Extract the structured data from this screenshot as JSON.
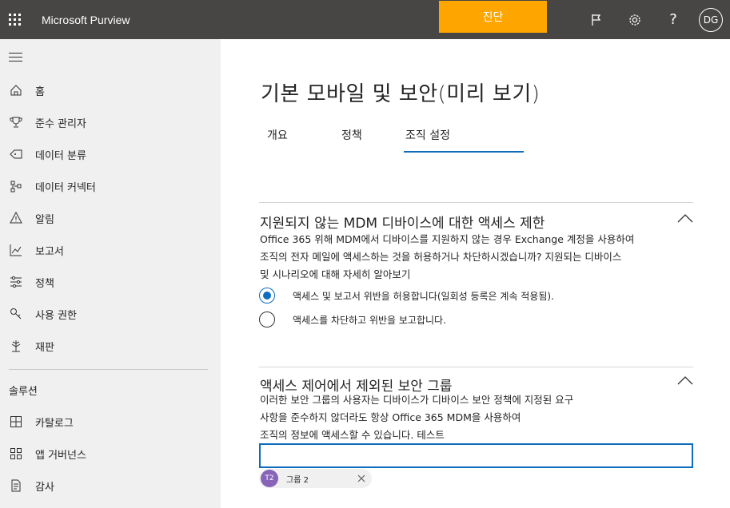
{
  "topbar": {
    "app_title": "Microsoft Purview",
    "diagnostic_label": "진단",
    "avatar_initials": "DG",
    "help_glyph": "?",
    "accent_color": "#ffa500"
  },
  "sidebar": {
    "items": [
      {
        "label": "홈",
        "icon": "home-icon"
      },
      {
        "label": "준수 관리자",
        "icon": "trophy-icon"
      },
      {
        "label": "데이터 분류",
        "icon": "tag-icon"
      },
      {
        "label": "데이터 커넥터",
        "icon": "connector-icon"
      },
      {
        "label": "알림",
        "icon": "alert-icon"
      },
      {
        "label": "보고서",
        "icon": "chart-icon"
      },
      {
        "label": "정책",
        "icon": "sliders-icon"
      },
      {
        "label": "사용 권한",
        "icon": "key-icon"
      },
      {
        "label": "재판",
        "icon": "tree-icon"
      }
    ],
    "section_label": "솔루션",
    "solutions": [
      {
        "label": "카탈로그",
        "icon": "catalog-icon"
      },
      {
        "label": "앱 거버넌스",
        "icon": "app-grid-icon"
      },
      {
        "label": "감사",
        "icon": "audit-icon"
      }
    ]
  },
  "main": {
    "title": "기본 모바일 및 보안(미리 보기)",
    "tabs": [
      {
        "label": "개요"
      },
      {
        "label": "정책"
      },
      {
        "label": "조직 설정"
      }
    ],
    "selected_tab": "조직 설정",
    "section1": {
      "title": "지원되지 않는 MDM 디바이스에 대한 액세스 제한",
      "desc_lines": [
        "Office 365 위해 MDM에서 디바이스를 지원하지 않는 경우 Exchange 계정을 사용하여",
        "조직의 전자 메일에 액세스하는 것을 허용하거나 차단하시겠습니까? 지원되는 디바이스",
        "및 시나리오에 대해 자세히 알아보기"
      ],
      "options": [
        {
          "label": "액세스 및 보고서 위반을 허용합니다(일회성 등록은 계속 적용됨).",
          "checked": true
        },
        {
          "label": "액세스를 차단하고 위반을 보고합니다.",
          "checked": false
        }
      ]
    },
    "section2": {
      "title": "액세스 제어에서 제외된 보안 그룹",
      "desc_lines": [
        "이러한 보안 그룹의 사용자는 디바이스가 디바이스 보안 정책에 지정된 요구",
        "사항을 준수하지 않더라도 항상 Office 365 MDM을 사용하여",
        "조직의 정보에 액세스할 수 있습니다. 테스트"
      ],
      "search_value": "",
      "chip": {
        "initials": "T2",
        "label": "그룹 2"
      }
    }
  }
}
